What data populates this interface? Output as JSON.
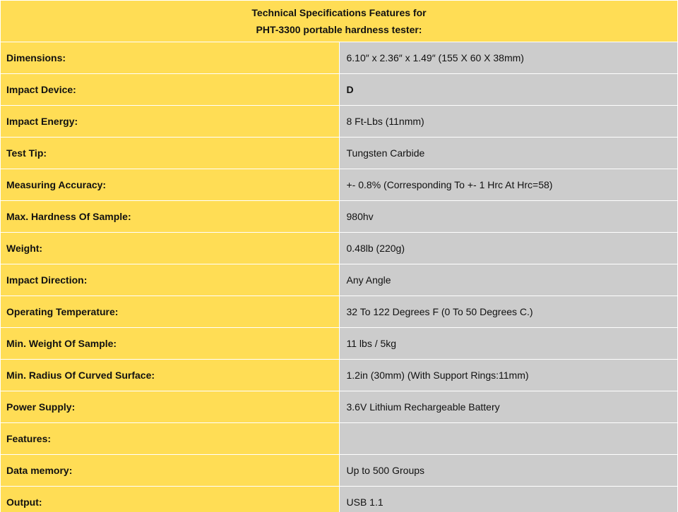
{
  "header": {
    "line1": "Technical Specifications Features for",
    "line2": "PHT-3300 portable hardness tester:"
  },
  "colors": {
    "label_background": "#ffdd55",
    "value_background": "#cccccc",
    "border": "#ffffff"
  },
  "rows": [
    {
      "label": "Dimensions:",
      "value": "6.10″ x 2.36″ x 1.49″ (155 X 60 X 38mm)"
    },
    {
      "label": "Impact Device:",
      "value": "D"
    },
    {
      "label": "Impact Energy:",
      "value": "8 Ft-Lbs (11nmm)"
    },
    {
      "label": "Test Tip:",
      "value": "Tungsten Carbide"
    },
    {
      "label": "Measuring Accuracy:",
      "value": "+- 0.8% (Corresponding To +- 1 Hrc At Hrc=58)"
    },
    {
      "label": "Max. Hardness Of Sample:",
      "value": "980hv"
    },
    {
      "label": "Weight:",
      "value": "0.48lb (220g)"
    },
    {
      "label": "Impact Direction:",
      "value": "Any Angle"
    },
    {
      "label": "Operating Temperature:",
      "value": "32 To 122 Degrees F (0 To 50 Degrees C.)"
    },
    {
      "label": "Min. Weight Of Sample:",
      "value": "11 lbs / 5kg"
    },
    {
      "label": "Min. Radius Of Curved Surface:",
      "value": "1.2in (30mm) (With Support Rings:11mm)"
    },
    {
      "label": "Power Supply:",
      "value": "3.6V Lithium Rechargeable Battery"
    },
    {
      "label": "Features:",
      "value": ""
    },
    {
      "label": "Data memory:",
      "value": "Up to 500 Groups"
    },
    {
      "label": "Output:",
      "value": "USB 1.1"
    }
  ]
}
